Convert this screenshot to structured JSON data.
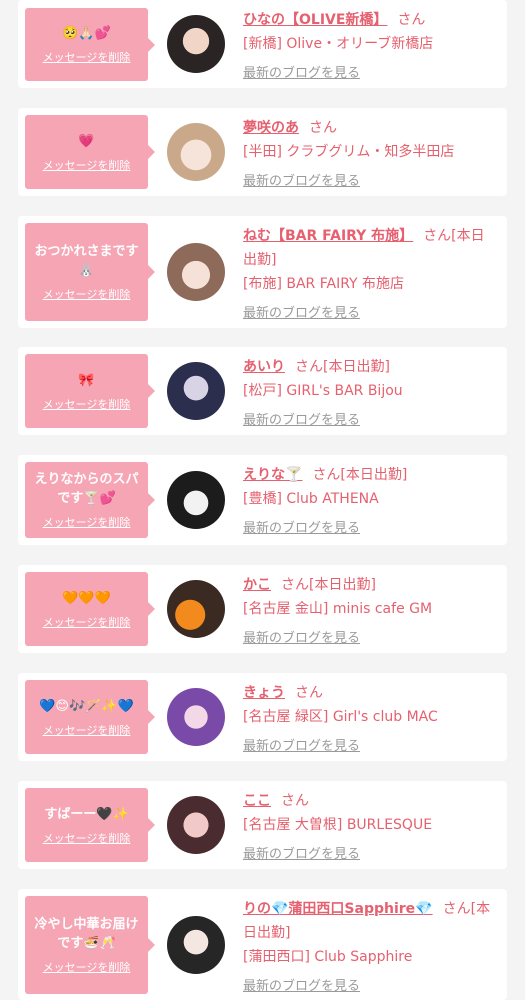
{
  "colors": {
    "accent": "#e5616f",
    "bubble": "#f6a5b4",
    "background": "#f4f4f4"
  },
  "cards": [
    {
      "message": "🥺🙏🏻💕",
      "delete_label": "メッセージを削除",
      "name": "ひなの【OLIVE新橋】",
      "suffix": "さん",
      "shop": "[新橋] Olive・オリーブ新橋店",
      "blog_label": "最新のブログを見る"
    },
    {
      "message": "💗",
      "delete_label": "メッセージを削除",
      "name": "夢咲のあ",
      "suffix": "さん",
      "shop": "[半田] クラブグリム・知多半田店",
      "blog_label": "最新のブログを見る"
    },
    {
      "message": "おつかれさまです🐰",
      "delete_label": "メッセージを削除",
      "name": "ねむ【BAR FAIRY 布施】",
      "suffix": "さん[本日出勤]",
      "shop": "[布施] BAR FAIRY 布施店",
      "blog_label": "最新のブログを見る"
    },
    {
      "message": "🎀",
      "delete_label": "メッセージを削除",
      "name": "あいり",
      "suffix": "さん[本日出勤]",
      "shop": "[松戸] GIRL's BAR Bijou",
      "blog_label": "最新のブログを見る"
    },
    {
      "message": "えりなからのスパです🍸💕",
      "delete_label": "メッセージを削除",
      "name": "えりな🍸",
      "suffix": "さん[本日出勤]",
      "shop": "[豊橋] Club ATHENA",
      "blog_label": "最新のブログを見る"
    },
    {
      "message": "🧡🧡🧡",
      "delete_label": "メッセージを削除",
      "name": "かこ",
      "suffix": "さん[本日出勤]",
      "shop": "[名古屋 金山] minis cafe GM",
      "blog_label": "最新のブログを見る"
    },
    {
      "message": "💙😊🎶🪄✨💙",
      "delete_label": "メッセージを削除",
      "name": "きょう",
      "suffix": "さん",
      "shop": "[名古屋 緑区] Girl's club MAC",
      "blog_label": "最新のブログを見る"
    },
    {
      "message": "すばーー🖤✨",
      "delete_label": "メッセージを削除",
      "name": "ここ",
      "suffix": "さん",
      "shop": "[名古屋 大曽根] BURLESQUE",
      "blog_label": "最新のブログを見る"
    },
    {
      "message": "冷やし中華お届けです🍜🥂",
      "delete_label": "メッセージを削除",
      "name": "りの💎蒲田西口Sapphire💎",
      "suffix": "さん[本日出勤]",
      "shop": "[蒲田西口] Club Sapphire",
      "blog_label": "最新のブログを見る"
    }
  ]
}
